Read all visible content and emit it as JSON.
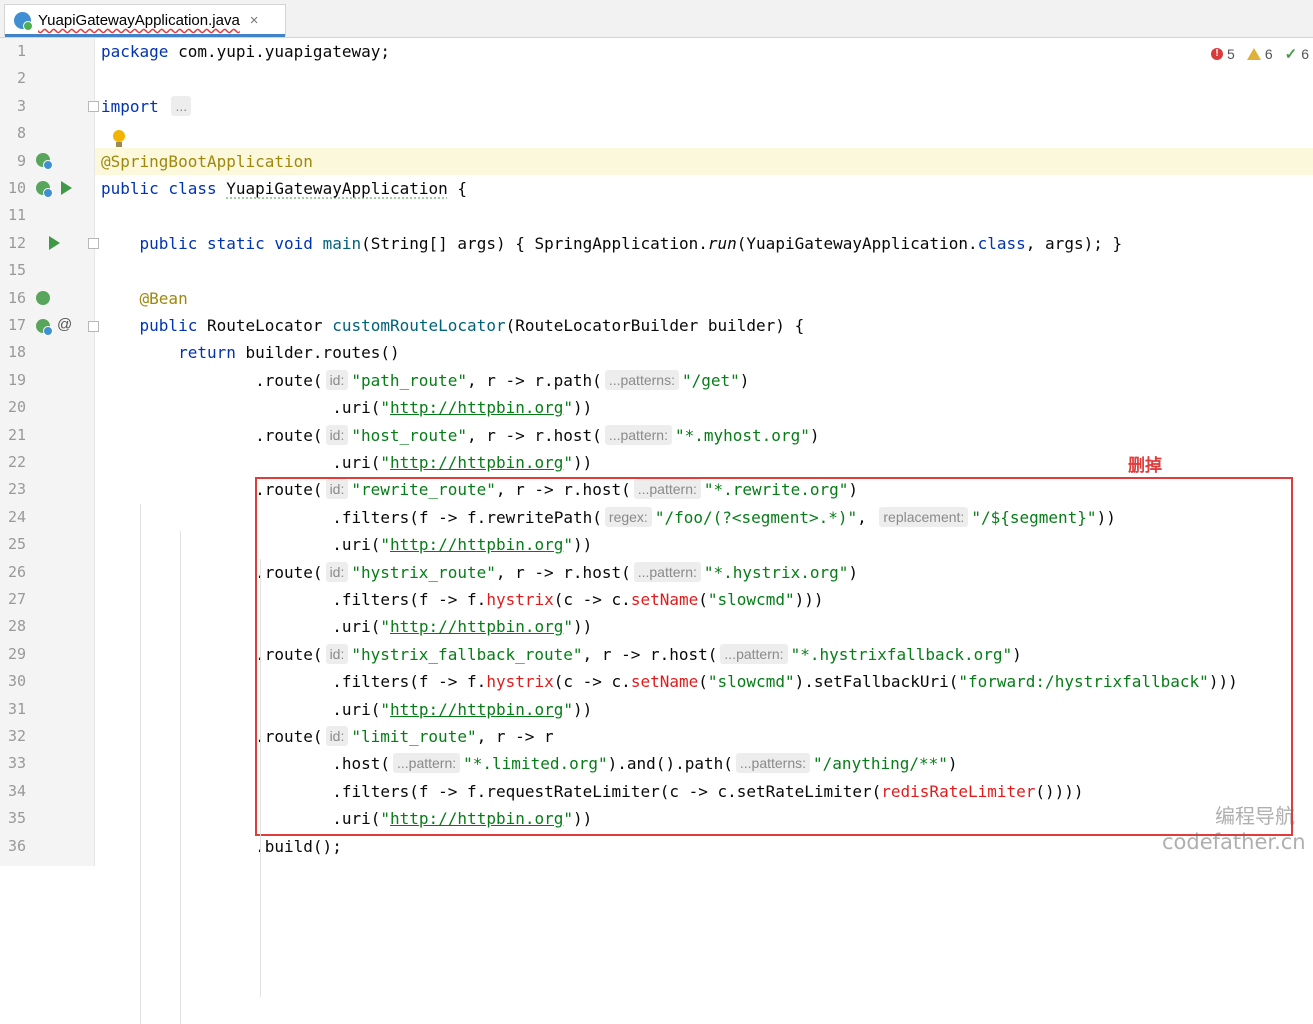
{
  "tab": {
    "title": "YuapiGatewayApplication.java",
    "close": "×"
  },
  "inspections": {
    "errors": "5",
    "warnings": "6",
    "weak_warnings": "6"
  },
  "annotation_label": "删掉",
  "watermark": {
    "line1": "编程导航",
    "line2": "codefather.cn"
  },
  "lines": [
    {
      "n": "1",
      "t": [
        {
          "c": "kw",
          "v": "package"
        },
        {
          "v": " com.yupi.yuapigateway;"
        }
      ]
    },
    {
      "n": "2",
      "t": []
    },
    {
      "n": "3",
      "t": [
        {
          "c": "kw",
          "v": "import"
        },
        {
          "v": " "
        },
        {
          "c": "hint",
          "v": "..."
        }
      ]
    },
    {
      "n": "8",
      "t": []
    },
    {
      "n": "9",
      "hl": true,
      "t": [
        {
          "c": "ann",
          "v": "@SpringBootApplication"
        }
      ]
    },
    {
      "n": "10",
      "t": [
        {
          "c": "kw",
          "v": "public class"
        },
        {
          "v": " "
        },
        {
          "c": "wavy",
          "v": "YuapiGatewayApplication"
        },
        {
          "v": " {"
        }
      ]
    },
    {
      "n": "11",
      "t": []
    },
    {
      "n": "12",
      "t": [
        {
          "v": "    "
        },
        {
          "c": "kw",
          "v": "public static void"
        },
        {
          "v": " "
        },
        {
          "c": "fn",
          "v": "main"
        },
        {
          "v": "(String[] args) { SpringApplication."
        },
        {
          "c": "it",
          "v": "run"
        },
        {
          "v": "(YuapiGatewayApplication."
        },
        {
          "c": "kw",
          "v": "class"
        },
        {
          "v": ", args); }"
        }
      ]
    },
    {
      "n": "15",
      "t": []
    },
    {
      "n": "16",
      "t": [
        {
          "v": "    "
        },
        {
          "c": "ann",
          "v": "@Bean"
        }
      ]
    },
    {
      "n": "17",
      "t": [
        {
          "v": "    "
        },
        {
          "c": "kw",
          "v": "public"
        },
        {
          "v": " RouteLocator "
        },
        {
          "c": "fn",
          "v": "customRouteLocator"
        },
        {
          "v": "(RouteLocatorBuilder builder) {"
        }
      ]
    },
    {
      "n": "18",
      "t": [
        {
          "v": "        "
        },
        {
          "c": "kw",
          "v": "return"
        },
        {
          "v": " builder.routes()"
        }
      ]
    },
    {
      "n": "19",
      "t": [
        {
          "v": "                .route("
        },
        {
          "c": "hint",
          "v": "id:"
        },
        {
          "c": "str",
          "v": "\"path_route\""
        },
        {
          "v": ", r -> r.path("
        },
        {
          "c": "hint",
          "v": "...patterns:"
        },
        {
          "c": "str",
          "v": "\"/get\""
        },
        {
          "v": ")"
        }
      ]
    },
    {
      "n": "20",
      "t": [
        {
          "v": "                        .uri("
        },
        {
          "c": "str",
          "v": "\""
        },
        {
          "c": "strlink",
          "v": "http://httpbin.org"
        },
        {
          "c": "str",
          "v": "\""
        },
        {
          "v": "))"
        }
      ]
    },
    {
      "n": "21",
      "t": [
        {
          "v": "                .route("
        },
        {
          "c": "hint",
          "v": "id:"
        },
        {
          "c": "str",
          "v": "\"host_route\""
        },
        {
          "v": ", r -> r.host("
        },
        {
          "c": "hint",
          "v": "...pattern:"
        },
        {
          "c": "str",
          "v": "\"*.myhost.org\""
        },
        {
          "v": ")"
        }
      ]
    },
    {
      "n": "22",
      "t": [
        {
          "v": "                        .uri("
        },
        {
          "c": "str",
          "v": "\""
        },
        {
          "c": "strlink",
          "v": "http://httpbin.org"
        },
        {
          "c": "str",
          "v": "\""
        },
        {
          "v": "))"
        }
      ]
    },
    {
      "n": "23",
      "t": [
        {
          "v": "                .route("
        },
        {
          "c": "hint",
          "v": "id:"
        },
        {
          "c": "str",
          "v": "\"rewrite_route\""
        },
        {
          "v": ", r -> r.host("
        },
        {
          "c": "hint",
          "v": "...pattern:"
        },
        {
          "c": "str",
          "v": "\"*.rewrite.org\""
        },
        {
          "v": ")"
        }
      ]
    },
    {
      "n": "24",
      "t": [
        {
          "v": "                        .filters(f -> f.rewritePath("
        },
        {
          "c": "hint",
          "v": "regex:"
        },
        {
          "c": "str",
          "v": "\"/foo/(?<segment>.*)\""
        },
        {
          "v": ", "
        },
        {
          "c": "hint",
          "v": "replacement:"
        },
        {
          "c": "str",
          "v": "\"/${segment}\""
        },
        {
          "v": "))"
        }
      ]
    },
    {
      "n": "25",
      "t": [
        {
          "v": "                        .uri("
        },
        {
          "c": "str",
          "v": "\""
        },
        {
          "c": "strlink",
          "v": "http://httpbin.org"
        },
        {
          "c": "str",
          "v": "\""
        },
        {
          "v": "))"
        }
      ]
    },
    {
      "n": "26",
      "t": [
        {
          "v": "                .route("
        },
        {
          "c": "hint",
          "v": "id:"
        },
        {
          "c": "str",
          "v": "\"hystrix_route\""
        },
        {
          "v": ", r -> r.host("
        },
        {
          "c": "hint",
          "v": "...pattern:"
        },
        {
          "c": "str",
          "v": "\"*.hystrix.org\""
        },
        {
          "v": ")"
        }
      ]
    },
    {
      "n": "27",
      "t": [
        {
          "v": "                        .filters(f -> f."
        },
        {
          "c": "red",
          "v": "hystrix"
        },
        {
          "v": "(c -> c."
        },
        {
          "c": "red",
          "v": "setName"
        },
        {
          "v": "("
        },
        {
          "c": "str",
          "v": "\"slowcmd\""
        },
        {
          "v": ")))"
        }
      ]
    },
    {
      "n": "28",
      "t": [
        {
          "v": "                        .uri("
        },
        {
          "c": "str",
          "v": "\""
        },
        {
          "c": "strlink",
          "v": "http://httpbin.org"
        },
        {
          "c": "str",
          "v": "\""
        },
        {
          "v": "))"
        }
      ]
    },
    {
      "n": "29",
      "t": [
        {
          "v": "                .route("
        },
        {
          "c": "hint",
          "v": "id:"
        },
        {
          "c": "str",
          "v": "\"hystrix_fallback_route\""
        },
        {
          "v": ", r -> r.host("
        },
        {
          "c": "hint",
          "v": "...pattern:"
        },
        {
          "c": "str",
          "v": "\"*.hystrixfallback.org\""
        },
        {
          "v": ")"
        }
      ]
    },
    {
      "n": "30",
      "t": [
        {
          "v": "                        .filters(f -> f."
        },
        {
          "c": "red",
          "v": "hystrix"
        },
        {
          "v": "(c -> c."
        },
        {
          "c": "red",
          "v": "setName"
        },
        {
          "v": "("
        },
        {
          "c": "str",
          "v": "\"slowcmd\""
        },
        {
          "v": ").setFallbackUri("
        },
        {
          "c": "str",
          "v": "\"forward:/hystrixfallback\""
        },
        {
          "v": ")))"
        }
      ]
    },
    {
      "n": "31",
      "t": [
        {
          "v": "                        .uri("
        },
        {
          "c": "str",
          "v": "\""
        },
        {
          "c": "strlink",
          "v": "http://httpbin.org"
        },
        {
          "c": "str",
          "v": "\""
        },
        {
          "v": "))"
        }
      ]
    },
    {
      "n": "32",
      "t": [
        {
          "v": "                .route("
        },
        {
          "c": "hint",
          "v": "id:"
        },
        {
          "c": "str",
          "v": "\"limit_route\""
        },
        {
          "v": ", r -> r"
        }
      ]
    },
    {
      "n": "33",
      "t": [
        {
          "v": "                        .host("
        },
        {
          "c": "hint",
          "v": "...pattern:"
        },
        {
          "c": "str",
          "v": "\"*.limited.org\""
        },
        {
          "v": ").and().path("
        },
        {
          "c": "hint",
          "v": "...patterns:"
        },
        {
          "c": "str",
          "v": "\"/anything/**\""
        },
        {
          "v": ")"
        }
      ]
    },
    {
      "n": "34",
      "t": [
        {
          "v": "                        .filters(f -> f.requestRateLimiter(c -> c.setRateLimiter("
        },
        {
          "c": "red",
          "v": "redisRateLimiter"
        },
        {
          "v": "())))"
        }
      ]
    },
    {
      "n": "35",
      "t": [
        {
          "v": "                        .uri("
        },
        {
          "c": "str",
          "v": "\""
        },
        {
          "c": "strlink",
          "v": "http://httpbin.org"
        },
        {
          "c": "str",
          "v": "\""
        },
        {
          "v": "))"
        }
      ]
    },
    {
      "n": "36",
      "t": [
        {
          "v": "                .build();"
        }
      ]
    }
  ]
}
